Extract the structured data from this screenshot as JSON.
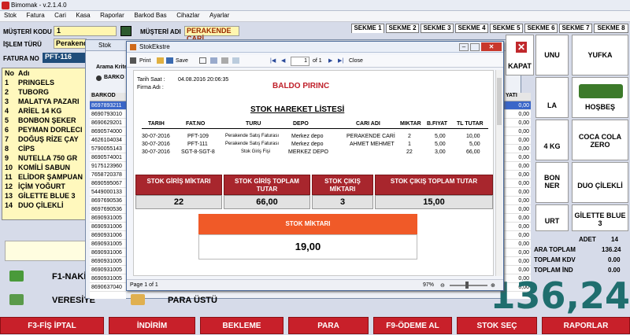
{
  "app": {
    "title": "Bimomak - v.2.1.4.0"
  },
  "menu": [
    "Stok",
    "Fatura",
    "Cari",
    "Kasa",
    "Raporlar",
    "Barkod Bas",
    "Cihazlar",
    "Ayarlar"
  ],
  "form": {
    "musteri_kodu_label": "MÜŞTERİ KODU",
    "musteri_kodu_value": "1",
    "musteri_adi_label": "MÜŞTERİ ADI",
    "musteri_adi_value": "PERAKENDE CARİ",
    "islem_turu_label": "İŞLEM TÜRÜ",
    "islem_turu_value": "Perakend",
    "fatura_no_label": "FATURA NO",
    "fatura_no_value": "PFT-116"
  },
  "cart": {
    "header_no": "No",
    "header_adi": "Adı",
    "items": [
      {
        "no": "1",
        "name": "PRINGELS"
      },
      {
        "no": "2",
        "name": "TUBORG"
      },
      {
        "no": "3",
        "name": "MALATYA PAZARI"
      },
      {
        "no": "4",
        "name": "ARİEL 14 KG"
      },
      {
        "no": "5",
        "name": "BONBON ŞEKER"
      },
      {
        "no": "6",
        "name": "PEYMAN DORLECI"
      },
      {
        "no": "7",
        "name": "DOĞUŞ RİZE ÇAY"
      },
      {
        "no": "8",
        "name": "CİPS"
      },
      {
        "no": "9",
        "name": "NUTELLA 750 GR"
      },
      {
        "no": "10",
        "name": "KOMİLİ SABUN"
      },
      {
        "no": "11",
        "name": "ELİDOR ŞAMPUAN"
      },
      {
        "no": "12",
        "name": "İÇİM YOĞURT"
      },
      {
        "no": "13",
        "name": "GİLETTE BLUE 3"
      },
      {
        "no": "14",
        "name": "DUO ÇİLEKLİ"
      }
    ]
  },
  "stok_window": {
    "title": "Stok",
    "kriter_label": "Arama Kriter",
    "radio_label": "BARKO",
    "barkod_header": "BARKOD",
    "barkods": [
      "8697893211",
      "8690793010",
      "8690629201",
      "8690574000",
      "4626104034",
      "5790055143",
      "8690574001",
      "9175123960",
      "7658720378",
      "8690595067",
      "5449000133",
      "8697690536",
      "8697690536",
      "8690931005",
      "8690931006",
      "8690931006",
      "8690931005",
      "8690931006",
      "8690931005",
      "8690931005",
      "8690931005",
      "8690637040"
    ],
    "right_header": "YATI",
    "right_vals": [
      "0,00",
      "0,00",
      "0,00",
      "0,00",
      "0,00",
      "0,00",
      "0,00",
      "0,00",
      "0,00",
      "0,00",
      "0,00",
      "0,00",
      "0,00",
      "0,00",
      "0,00",
      "0,00",
      "0,00",
      "0,00",
      "0,00",
      "0,00",
      "0,00",
      "0,00"
    ]
  },
  "ekstre": {
    "title": "StokEkstre",
    "toolbar": {
      "print": "Print",
      "save": "Save",
      "page_value": "1",
      "page_of": "of 1",
      "close": "Close"
    },
    "tarih_label": "Tarih Saat :",
    "tarih_value": "04.08.2016 20:06:35",
    "firma_label": "Firma Adı :",
    "product": "BALDO PIRINC",
    "report_title": "STOK HAREKET LİSTESİ",
    "columns": [
      "TARIH",
      "FAT.NO",
      "TURU",
      "DEPO",
      "CARI ADI",
      "MIKTAR",
      "B.FIYAT",
      "TL TUTAR"
    ],
    "rows": [
      [
        "30-07-2016",
        "PFT-109",
        "Perakende Satış Faturası",
        "Merkez depo",
        "PERAKENDE CARİ",
        "2",
        "5,00",
        "10,00"
      ],
      [
        "30-07-2016",
        "PFT-111",
        "Perakende Satış Faturası",
        "Merkez depo",
        "AHMET MEHMET",
        "1",
        "5,00",
        "5,00"
      ],
      [
        "30-07-2016",
        "SGT-8-SGT-8",
        "Stok Giriş Fişi",
        "MERKEZ DEPO",
        "",
        "22",
        "3,00",
        "66,00"
      ]
    ],
    "summary": [
      {
        "label": "STOK GİRİŞ MİKTARI",
        "value": "22"
      },
      {
        "label": "STOK GİRİŞ TOPLAM TUTAR",
        "value": "66,00"
      },
      {
        "label": "STOK ÇIKIŞ MİKTARI",
        "value": "3"
      },
      {
        "label": "STOK ÇIKIŞ TOPLAM TUTAR",
        "value": "15,00"
      }
    ],
    "stok_miktari_label": "STOK MİKTARI",
    "stok_miktari_value": "19,00",
    "status_page": "Page 1 of 1",
    "zoom": "97%"
  },
  "tabs": [
    "SEKME 1",
    "SEKME 2",
    "SEKME 3",
    "SEKME 4",
    "SEKME 5",
    "SEKME 6",
    "SEKME 7",
    "SEKME 8"
  ],
  "tiles": {
    "kapat": "KAPAT",
    "unu": "UNU",
    "yufka": "YUFKA",
    "la": "LA",
    "hosbes": "HOŞBEŞ",
    "kg": "4 KG",
    "coca": "COCA COLA ZERO",
    "bon": "BON",
    "ner": "NER",
    "duo": "DUO ÇİLEKLİ",
    "urt": "URT",
    "gilette": "GİLETTE BLUE 3"
  },
  "totals": {
    "adet_label": "ADET",
    "adet_value": "14",
    "ara_label": "ARA TOPLAM",
    "ara_value": "136.24",
    "kdv_label": "TOPLAM KDV",
    "kdv_value": "0.00",
    "ind_label": "TOPLAM İND",
    "ind_value": "0.00",
    "grand": "136,24"
  },
  "left_buttons": {
    "f1": "F1-NAKİT",
    "veresiye": "VERESİYE",
    "para_ustu": "PARA ÜSTÜ"
  },
  "bottom": [
    "F3-FİŞ İPTAL",
    "İNDİRİM",
    "BEKLEME",
    "PARA",
    "F9-ÖDEME AL",
    "STOK SEÇ",
    "RAPORLAR"
  ]
}
